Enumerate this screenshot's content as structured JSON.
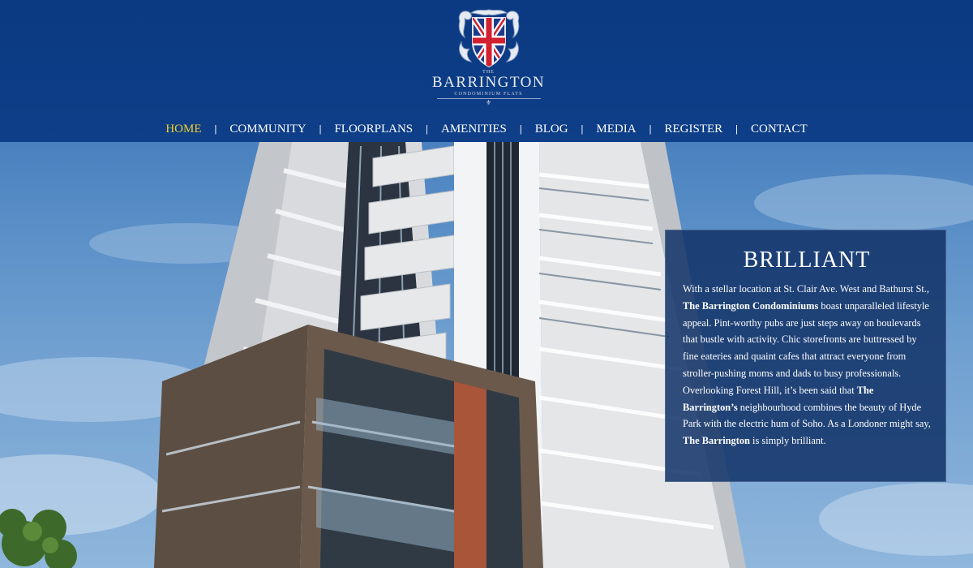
{
  "brand": {
    "the": "THE",
    "name": "BARRINGTON",
    "subtitle": "CONDOMINIUM FLATS",
    "fleur": "⚜"
  },
  "nav": {
    "items": [
      {
        "label": "HOME",
        "active": true
      },
      {
        "label": "COMMUNITY",
        "active": false
      },
      {
        "label": "FLOORPLANS",
        "active": false
      },
      {
        "label": "AMENITIES",
        "active": false
      },
      {
        "label": "BLOG",
        "active": false
      },
      {
        "label": "MEDIA",
        "active": false
      },
      {
        "label": "REGISTER",
        "active": false
      },
      {
        "label": "CONTACT",
        "active": false
      }
    ],
    "separator": "|"
  },
  "panel": {
    "title": "BRILLIANT",
    "p1": "With a stellar location at St. Clair Ave. West and Bathurst St., ",
    "b1": "The Barrington Condominiums",
    "p2": " boast unparalleled lifestyle appeal. Pint-worthy pubs are just steps away on boulevards that bustle with activity. Chic storefronts are buttressed by fine eateries and quaint cafes that attract everyone from stroller-pushing moms and dads to busy professionals. Overlooking Forest Hill, it’s been said that ",
    "b2": "The Barrington’s",
    "p3": " neighbourhood combines the beauty of Hyde Park with the electric hum of Soho. As a Londoner might say, ",
    "b3": "The Barrington",
    "p4": " is simply brilliant."
  },
  "colors": {
    "header_bg": "#0d3d86",
    "nav_active": "#f2cf2a",
    "panel_bg": "#123268"
  },
  "icons": {
    "logo": "union-jack-crest-icon"
  }
}
